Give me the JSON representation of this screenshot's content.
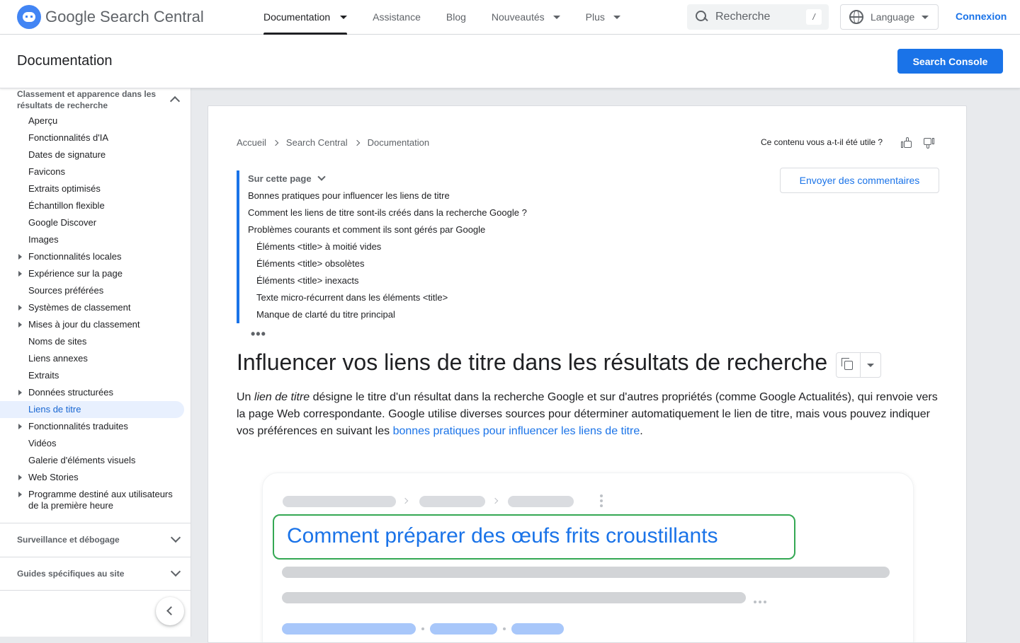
{
  "header": {
    "logo_text": "Google Search Central",
    "nav": [
      {
        "label": "Documentation",
        "has_menu": true,
        "active": true
      },
      {
        "label": "Assistance",
        "has_menu": false
      },
      {
        "label": "Blog",
        "has_menu": false
      },
      {
        "label": "Nouveautés",
        "has_menu": true
      },
      {
        "label": "Plus",
        "has_menu": true
      }
    ],
    "search_placeholder": "Recherche",
    "search_shortcut": "/",
    "language_label": "Language",
    "login_label": "Connexion"
  },
  "subheader": {
    "title": "Documentation",
    "console_button": "Search Console"
  },
  "sidebar": {
    "section_title": "Classement et apparence dans les résultats de recherche",
    "items": [
      {
        "label": "Aperçu",
        "expandable": false
      },
      {
        "label": "Fonctionnalités d'IA",
        "expandable": false
      },
      {
        "label": "Dates de signature",
        "expandable": false
      },
      {
        "label": "Favicons",
        "expandable": false
      },
      {
        "label": "Extraits optimisés",
        "expandable": false
      },
      {
        "label": "Échantillon flexible",
        "expandable": false
      },
      {
        "label": "Google Discover",
        "expandable": false
      },
      {
        "label": "Images",
        "expandable": false
      },
      {
        "label": "Fonctionnalités locales",
        "expandable": true
      },
      {
        "label": "Expérience sur la page",
        "expandable": true
      },
      {
        "label": "Sources préférées",
        "expandable": false
      },
      {
        "label": "Systèmes de classement",
        "expandable": true
      },
      {
        "label": "Mises à jour du classement",
        "expandable": true
      },
      {
        "label": "Noms de sites",
        "expandable": false
      },
      {
        "label": "Liens annexes",
        "expandable": false
      },
      {
        "label": "Extraits",
        "expandable": false
      },
      {
        "label": "Données structurées",
        "expandable": true
      },
      {
        "label": "Liens de titre",
        "expandable": false,
        "active": true
      },
      {
        "label": "Fonctionnalités traduites",
        "expandable": true
      },
      {
        "label": "Vidéos",
        "expandable": false
      },
      {
        "label": "Galerie d'éléments visuels",
        "expandable": false
      },
      {
        "label": "Web Stories",
        "expandable": true
      },
      {
        "label": "Programme destiné aux utilisateurs de la première heure",
        "expandable": true,
        "two_line": true
      }
    ],
    "groups": [
      {
        "label": "Surveillance et débogage"
      },
      {
        "label": "Guides spécifiques au site"
      }
    ]
  },
  "breadcrumb": [
    "Accueil",
    "Search Central",
    "Documentation"
  ],
  "feedback": {
    "question": "Ce contenu vous a-t-il été utile ?",
    "send_button": "Envoyer des commentaires"
  },
  "toc": {
    "heading": "Sur cette page",
    "items": [
      {
        "label": "Bonnes pratiques pour influencer les liens de titre",
        "level": 1
      },
      {
        "label": "Comment les liens de titre sont-ils créés dans la recherche Google ?",
        "level": 1
      },
      {
        "label": "Problèmes courants et comment ils sont gérés par Google",
        "level": 1
      },
      {
        "label": "Éléments <title> à moitié vides",
        "level": 2
      },
      {
        "label": "Éléments <title> obsolètes",
        "level": 2
      },
      {
        "label": "Éléments <title> inexacts",
        "level": 2
      },
      {
        "label": "Texte micro-récurrent dans les éléments <title>",
        "level": 2
      },
      {
        "label": "Manque de clarté du titre principal",
        "level": 2
      }
    ],
    "more": "•••"
  },
  "article": {
    "title": "Influencer vos liens de titre dans les résultats de recherche",
    "intro_em": "lien de titre",
    "intro_before": "Un ",
    "intro_mid": " désigne le titre d'un résultat dans la recherche Google et sur d'autres propriétés (comme Google Actualités), qui renvoie vers la page Web correspondante. Google utilise diverses sources pour déterminer automatiquement le lien de titre, mais vous pouvez indiquer vos préférences en suivant les ",
    "intro_link": "bonnes pratiques pour influencer les liens de titre",
    "intro_after": "."
  },
  "illustration": {
    "result_title": "Comment préparer des œufs frits croustillants",
    "highlight_color": "#34a853"
  },
  "colors": {
    "accent": "#1a73e8",
    "active_bg": "#e8f0fe"
  }
}
